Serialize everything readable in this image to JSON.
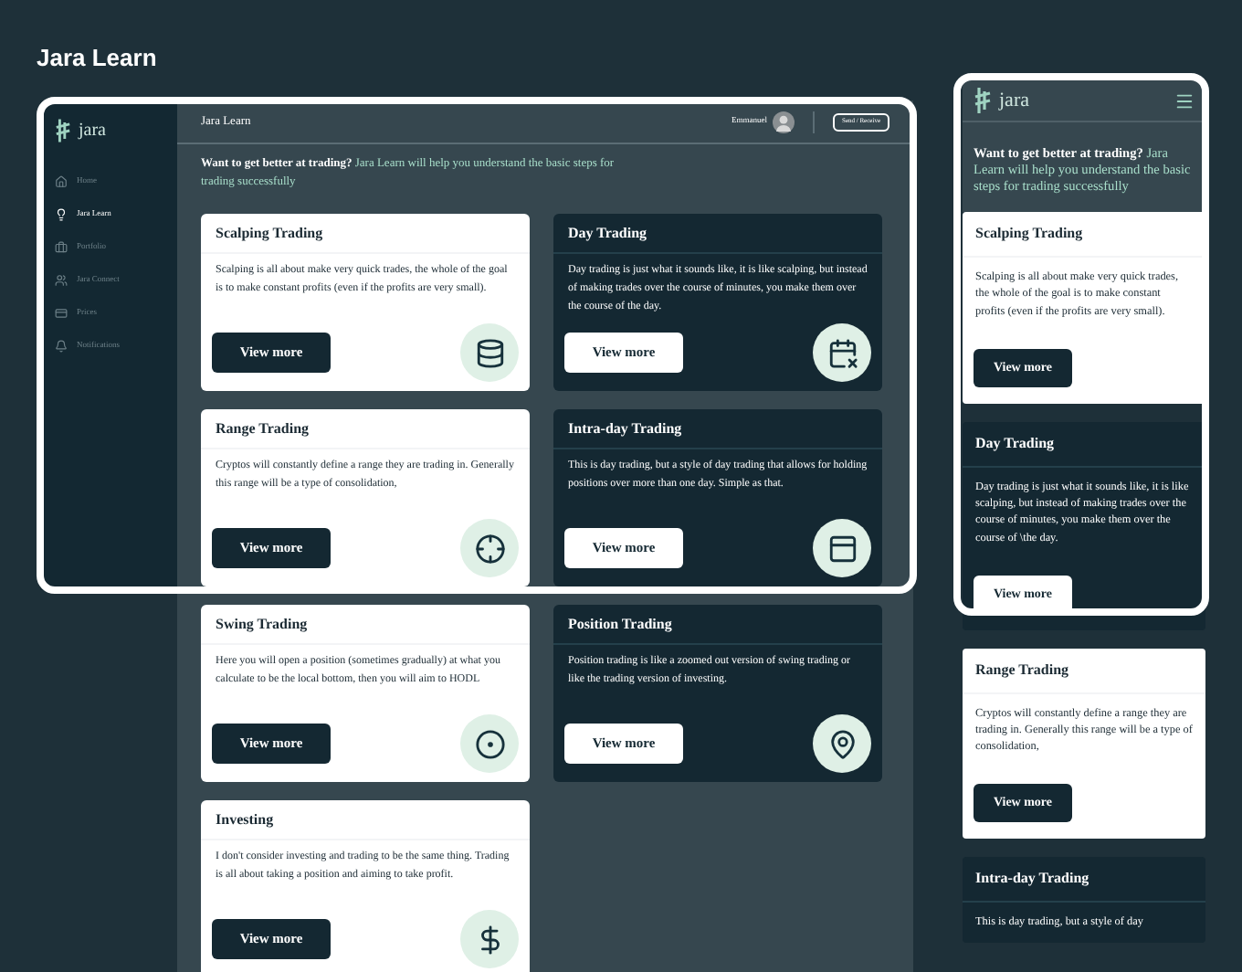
{
  "page_title": "Jara Learn",
  "desktop": {
    "logo": "jara",
    "sidebar": [
      {
        "label": "Home",
        "selected": false
      },
      {
        "label": "Jara Learn",
        "selected": true
      },
      {
        "label": "Portfolio",
        "selected": false
      },
      {
        "label": "Jara Connect",
        "selected": false
      },
      {
        "label": "Prices",
        "selected": false
      },
      {
        "label": "Notifications",
        "selected": false
      }
    ],
    "header": {
      "title": "Jara Learn",
      "user": "Emmanuel",
      "button": "Send / Receive"
    },
    "intro": {
      "lead": "Want to get better at trading?",
      "rest": "Jara Learn will help you understand the basic steps for trading successfully"
    },
    "cards": [
      {
        "title": "Scalping Trading",
        "text": "Scalping is all about make very quick trades, the whole of the goal is to make constant profits (even if the profits are very small).",
        "button": "View more",
        "kind": "light"
      },
      {
        "title": "Day Trading",
        "text": "Day trading is just what it sounds like, it is like scalping, but instead of making trades over the course of minutes, you make them over the course of the day.",
        "button": "View more",
        "kind": "dark"
      },
      {
        "title": "Range Trading",
        "text": "Cryptos will constantly define a range they are trading in. Generally this range will be a type of consolidation,",
        "button": "View more",
        "kind": "light"
      },
      {
        "title": "Intra-day Trading",
        "text": "This is day trading, but a style of day trading that allows for holding positions over more than one day. Simple as that.",
        "button": "View more",
        "kind": "dark"
      },
      {
        "title": "Swing Trading",
        "text": "Here you will open a position (sometimes gradually) at what you calculate to be the local bottom, then you will aim to HODL",
        "button": "View more",
        "kind": "light"
      },
      {
        "title": "Position Trading",
        "text": "Position trading is like a zoomed out version of swing trading or like the trading version of investing.",
        "button": "View more",
        "kind": "dark"
      },
      {
        "title": "Investing",
        "text": "I don't consider investing and trading to be the same thing. Trading is all about taking a position and aiming to take profit.",
        "button": "View more",
        "kind": "light"
      }
    ]
  },
  "mobile": {
    "logo": "jara",
    "intro": {
      "lead": "Want to get better at trading?",
      "rest": "Jara Learn will help you understand the basic steps for trading successfully"
    },
    "cards": [
      {
        "title": "Scalping Trading",
        "text": "Scalping is all about make very quick trades, the whole of the goal is to make constant profits (even if the profits are very small).",
        "button": "View more",
        "kind": "light"
      },
      {
        "title": "Day Trading",
        "text": "Day trading is just what it sounds like, it is like scalping, but instead of making trades over the course of minutes, you make them over the course of \\the day.",
        "button": "View more",
        "kind": "dark"
      },
      {
        "title": "Range Trading",
        "text": "Cryptos will constantly define a range they are trading in. Generally this range will be a type of consolidation,",
        "button": "View more",
        "kind": "light"
      },
      {
        "title": "Intra-day Trading",
        "text": "This is day trading, but a style of day",
        "kind": "dark"
      }
    ]
  }
}
